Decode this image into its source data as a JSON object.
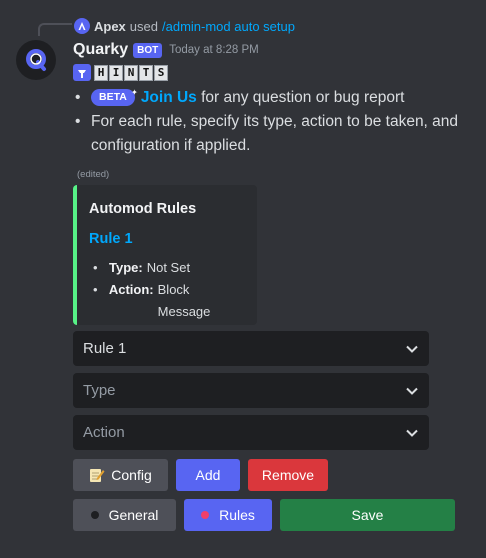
{
  "reply": {
    "author": "Apex",
    "verb": "used",
    "command": "/admin-mod auto setup"
  },
  "message": {
    "username": "Quarky",
    "bot_tag": "BOT",
    "timestamp": "Today at 8:28 PM",
    "hints": [
      "H",
      "I",
      "N",
      "T",
      "S"
    ],
    "bullets": {
      "beta_badge": "BETA",
      "join_link": "Join Us",
      "join_rest": "for any question or bug report",
      "rule_info": "For each rule, specify its type, action to be taken, and configuration if applied."
    },
    "edited": "(edited)"
  },
  "embed": {
    "title": "Automod Rules",
    "rule_name": "Rule 1",
    "type_label": "Type:",
    "type_value": "Not Set",
    "action_label": "Action:",
    "action_value": "Block Message",
    "accent_color": "#57f287"
  },
  "selects": {
    "rule": "Rule 1",
    "type_placeholder": "Type",
    "action_placeholder": "Action"
  },
  "buttons": {
    "config": "Config",
    "add": "Add",
    "remove": "Remove",
    "general": "General",
    "rules": "Rules",
    "save": "Save"
  },
  "colors": {
    "background": "#313338",
    "blurple": "#5865f2",
    "red": "#da373c",
    "green": "#248046",
    "grey": "#4e5058",
    "link": "#00a8fc",
    "rules_dot": "#f23f6a",
    "general_dot": "#1e1f22"
  }
}
